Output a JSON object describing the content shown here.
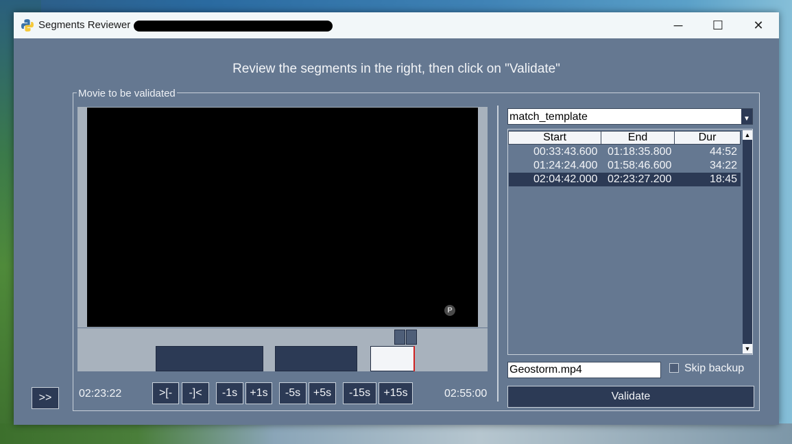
{
  "window": {
    "title": "Segments Reviewer -",
    "minimize": "─",
    "maximize": "☐",
    "close": "✕"
  },
  "instruction": "Review the segments in the right, then click on \"Validate\"",
  "movie_frame": {
    "legend": "Movie to be validated",
    "watermark": "P"
  },
  "timeline": {
    "current_time": "02:23:22",
    "total_time": "02:55:00"
  },
  "controls": {
    "expand": ">>",
    "set_start": ">[-",
    "set_end": "-]<",
    "minus_1s": "-1s",
    "plus_1s": "+1s",
    "minus_5s": "-5s",
    "plus_5s": "+5s",
    "minus_15s": "-15s",
    "plus_15s": "+15s"
  },
  "detector": {
    "selected": "match_template"
  },
  "segments": {
    "headers": [
      "Start",
      "End",
      "Dur"
    ],
    "rows": [
      {
        "start": "00:33:43.600",
        "end": "01:18:35.800",
        "dur": "44:52"
      },
      {
        "start": "01:24:24.400",
        "end": "01:58:46.600",
        "dur": "34:22"
      },
      {
        "start": "02:04:42.000",
        "end": "02:23:27.200",
        "dur": "18:45"
      }
    ],
    "selected_index": 2
  },
  "output": {
    "filename": "Geostorm.mp4",
    "skip_backup_label": "Skip backup",
    "skip_backup_checked": false,
    "validate_label": "Validate"
  },
  "colors": {
    "window_bg": "#657891",
    "button_bg": "#2c3a55",
    "playhead": "#d02020"
  }
}
